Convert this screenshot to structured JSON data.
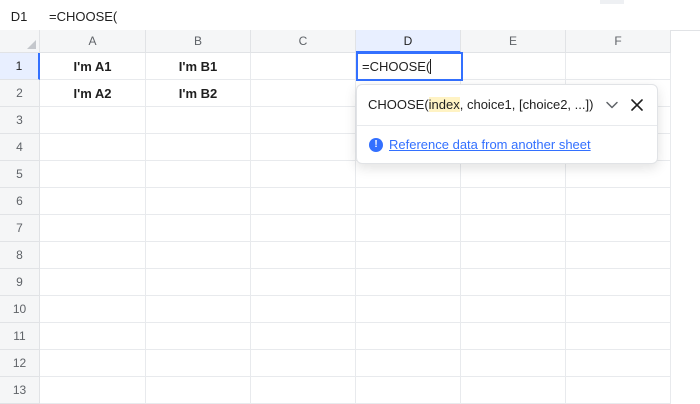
{
  "formula_bar": {
    "cell_ref": "D1",
    "content": "=CHOOSE("
  },
  "columns": [
    "A",
    "B",
    "C",
    "D",
    "E",
    "F"
  ],
  "rows": [
    "1",
    "2",
    "3",
    "4",
    "5",
    "6",
    "7",
    "8",
    "9",
    "10",
    "11",
    "12",
    "13"
  ],
  "cells": {
    "A1": "I'm A1",
    "B1": "I'm B1",
    "A2": "I'm A2",
    "B2": "I'm B2"
  },
  "active_cell": {
    "ref": "D1",
    "text": "=CHOOSE("
  },
  "function_helper": {
    "func_name": "CHOOSE(",
    "highlighted_param": "index",
    "rest_params": ", choice1, [choice2, ...])",
    "link_text": "Reference data from another sheet",
    "info_icon": "info-circle-icon",
    "expand_icon": "chevron-down-icon",
    "close_icon": "close-icon"
  },
  "colors": {
    "accent": "#3370ff",
    "param_highlight": "#fff3c4",
    "header_bg": "#f5f6f7",
    "active_header_bg": "#e8efff"
  }
}
